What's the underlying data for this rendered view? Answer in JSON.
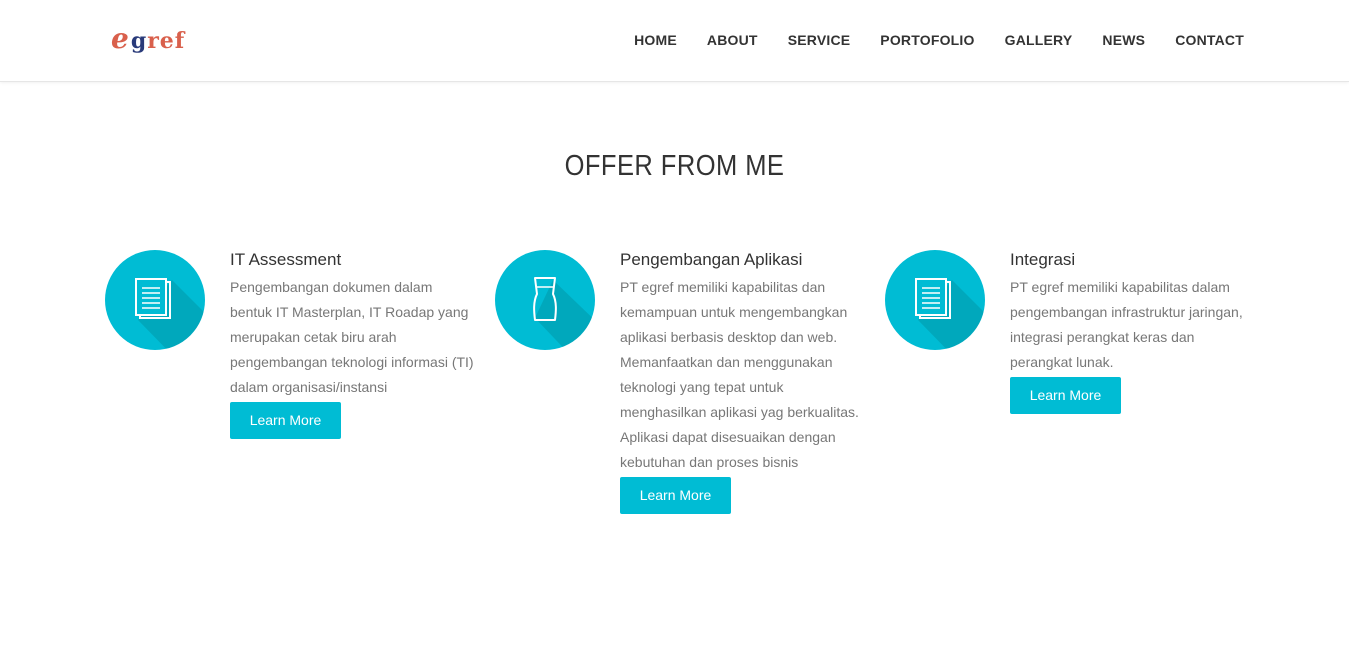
{
  "brand": {
    "logo_e": "e",
    "logo_g": "g",
    "logo_ref": "ref"
  },
  "nav": {
    "items": [
      "HOME",
      "ABOUT",
      "SERVICE",
      "PORTOFOLIO",
      "GALLERY",
      "NEWS",
      "CONTACT"
    ]
  },
  "section": {
    "title": "OFFER FROM ME"
  },
  "cards": [
    {
      "icon": "document-icon",
      "title": "IT Assessment",
      "text": "Pengembangan dokumen dalam bentuk IT Masterplan, IT Roadap yang merupakan cetak biru arah pengembangan teknologi informasi (TI) dalam organisasi/instansi",
      "button": "Learn More"
    },
    {
      "icon": "glass-icon",
      "title": "Pengembangan Aplikasi",
      "text": "PT egref memiliki kapabilitas dan kemampuan untuk mengembangkan aplikasi berbasis desktop dan web. Memanfaatkan dan menggunakan teknologi yang tepat untuk menghasilkan aplikasi yag berkualitas. Aplikasi dapat disesuaikan dengan kebutuhan dan proses bisnis",
      "button": "Learn More"
    },
    {
      "icon": "document-icon",
      "title": "Integrasi",
      "text": "PT egref memiliki kapabilitas dalam pengembangan infrastruktur jaringan, integrasi perangkat keras dan perangkat lunak.",
      "button": "Learn More"
    }
  ],
  "colors": {
    "accent": "#00bcd4",
    "accent_shadow": "#0097a7",
    "logo_red": "#d9604c",
    "logo_blue": "#2a3b7a"
  }
}
